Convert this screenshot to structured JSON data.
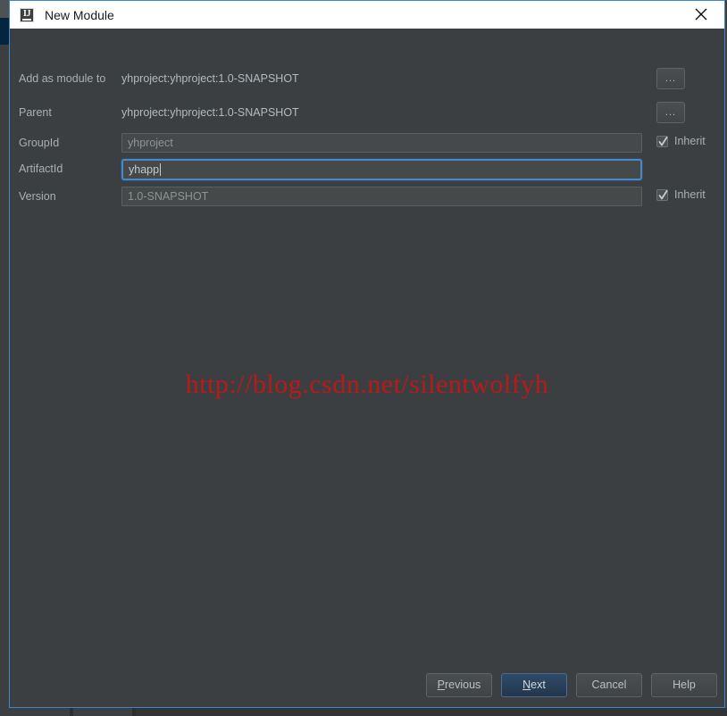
{
  "window": {
    "title": "New Module",
    "app_icon": "intellij-idea-icon",
    "close_icon": "close-icon",
    "border_color": "#3a88c8",
    "titlebar_bg": "#ffffff",
    "body_bg": "#3c3f41"
  },
  "form": {
    "rows": [
      {
        "name": "add-as-module-to",
        "label": "Add as module to",
        "type": "static",
        "value": "yhproject:yhproject:1.0-SNAPSHOT",
        "browse_label": "...",
        "has_browse": true,
        "has_inherit": false
      },
      {
        "name": "parent",
        "label": "Parent",
        "type": "static",
        "value": "yhproject:yhproject:1.0-SNAPSHOT",
        "browse_label": "...",
        "has_browse": true,
        "has_inherit": false
      },
      {
        "name": "group-id",
        "label": "GroupId",
        "type": "input",
        "value": "yhproject",
        "focused": false,
        "disabled": true,
        "has_browse": false,
        "has_inherit": true,
        "inherit_label": "Inherit",
        "inherit_checked": true
      },
      {
        "name": "artifact-id",
        "label": "ArtifactId",
        "type": "input",
        "value": "yhapp",
        "focused": true,
        "disabled": false,
        "has_browse": false,
        "has_inherit": false
      },
      {
        "name": "version",
        "label": "Version",
        "type": "input",
        "value": "1.0-SNAPSHOT",
        "focused": false,
        "disabled": true,
        "has_browse": false,
        "has_inherit": true,
        "inherit_label": "Inherit",
        "inherit_checked": true
      }
    ]
  },
  "watermark": {
    "text": "http://blog.csdn.net/silentwolfyh",
    "color": "#b81a1a"
  },
  "footer": {
    "buttons": [
      {
        "name": "previous-button",
        "label": "Previous",
        "mnemonic": "P",
        "default": false
      },
      {
        "name": "next-button",
        "label": "Next",
        "mnemonic": "N",
        "default": true
      },
      {
        "name": "cancel-button",
        "label": "Cancel",
        "mnemonic": "",
        "default": false
      },
      {
        "name": "help-button",
        "label": "Help",
        "mnemonic": "",
        "default": false
      }
    ],
    "default_accent": "#2f4a68"
  }
}
